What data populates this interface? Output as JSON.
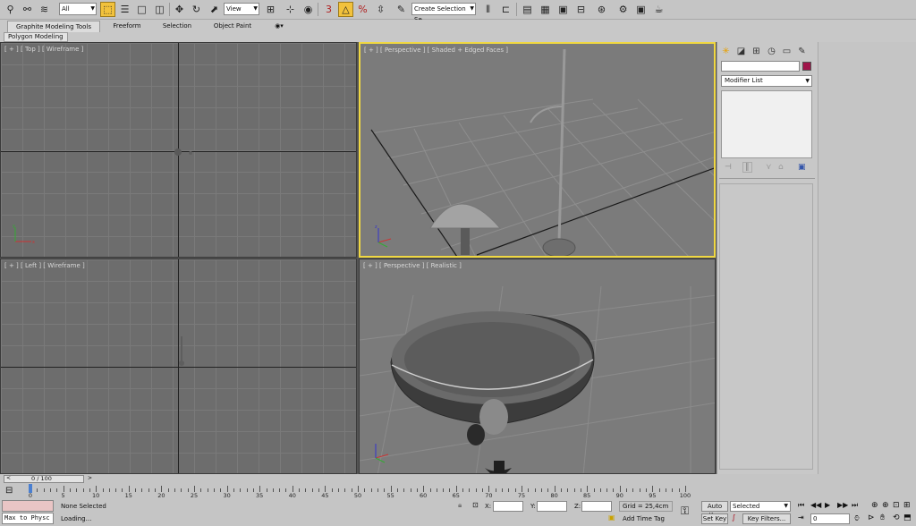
{
  "toolbar": {
    "filter_value": "All",
    "refcoord_value": "View",
    "selection_set_placeholder": "Create Selection Se"
  },
  "ribbon": {
    "tabs": [
      "Graphite Modeling Tools",
      "Freeform",
      "Selection",
      "Object Paint"
    ],
    "sub_tab": "Polygon Modeling"
  },
  "viewports": {
    "top": "[ + ] [ Top ] [ Wireframe ]",
    "perspective_shaded": "[ + ] [ Perspective ] [ Shaded + Edged Faces ]",
    "left": "[ + ] [ Left ] [ Wireframe ]",
    "perspective_realistic": "[ + ] [ Perspective ] [ Realistic ]"
  },
  "command_panel": {
    "modifier_list": "Modifier List",
    "object_color": "#a0154a"
  },
  "timeline": {
    "frame_readout": "0 / 100",
    "ticks": [
      "0",
      "5",
      "10",
      "15",
      "20",
      "25",
      "30",
      "35",
      "40",
      "45",
      "50",
      "55",
      "60",
      "65",
      "70",
      "75",
      "80",
      "85",
      "90",
      "95",
      "100"
    ]
  },
  "status": {
    "maxscript": "Max to Physc",
    "selection": "None Selected",
    "prompt": "Loading...",
    "x_label": "X:",
    "y_label": "Y:",
    "z_label": "Z:",
    "grid": "Grid = 25,4cm",
    "add_time_tag": "Add Time Tag",
    "auto_key": "Auto Key",
    "set_key": "Set Key",
    "selected": "Selected",
    "key_filters": "Key Filters...",
    "frame_value": "0"
  },
  "colors": {
    "active_viewport": "#f0d842",
    "highlight_button": "#f2c23c"
  }
}
